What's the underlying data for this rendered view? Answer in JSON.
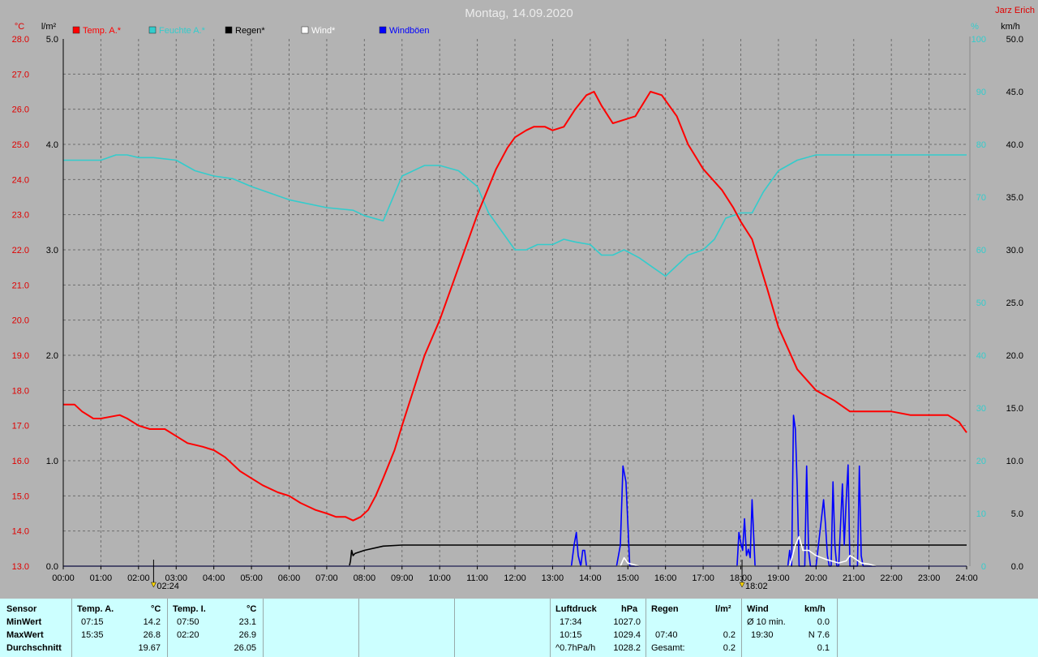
{
  "title": "Montag, 14.09.2020",
  "author": "Jarz Erich",
  "axes": {
    "left_temp_unit": "°C",
    "left_rain_unit": "l/m²",
    "right_hum_unit": "%",
    "right_wind_unit": "km/h",
    "temp_ticks": [
      "28.0",
      "27.0",
      "26.0",
      "25.0",
      "24.0",
      "23.0",
      "22.0",
      "21.0",
      "20.0",
      "19.0",
      "18.0",
      "17.0",
      "16.0",
      "15.0",
      "14.0",
      "13.0"
    ],
    "rain_ticks": [
      "5.0",
      "4.0",
      "3.0",
      "2.0",
      "1.0",
      "0.0"
    ],
    "hum_ticks": [
      "100",
      "90",
      "80",
      "70",
      "60",
      "50",
      "40",
      "30",
      "20",
      "10",
      "0"
    ],
    "wind_ticks": [
      "50.0",
      "45.0",
      "40.0",
      "35.0",
      "30.0",
      "25.0",
      "20.0",
      "15.0",
      "10.0",
      "5.0",
      "0.0"
    ],
    "time_ticks": [
      "00:00",
      "01:00",
      "02:00",
      "03:00",
      "04:00",
      "05:00",
      "06:00",
      "07:00",
      "08:00",
      "09:00",
      "10:00",
      "11:00",
      "12:00",
      "13:00",
      "14:00",
      "15:00",
      "16:00",
      "17:00",
      "18:00",
      "19:00",
      "20:00",
      "21:00",
      "22:00",
      "23:00",
      "24:00"
    ],
    "sunrise_label": "02:24",
    "sunset_label": "18:02"
  },
  "colors": {
    "temp": "#ff0000",
    "humidity": "#33cccc",
    "rain": "#000000",
    "wind": "#ffffff",
    "gusts": "#0000ff"
  },
  "chart_data": {
    "type": "line",
    "x_unit": "time of day (h)",
    "xlim": [
      0,
      24
    ],
    "series": [
      {
        "name": "Temp. A.*",
        "axis": "temp",
        "ylim": [
          13,
          28
        ],
        "x": [
          0,
          0.3,
          0.5,
          0.8,
          1.0,
          1.5,
          1.7,
          2.0,
          2.3,
          2.7,
          3.0,
          3.3,
          3.7,
          4.0,
          4.3,
          4.7,
          5.0,
          5.3,
          5.7,
          6.0,
          6.3,
          6.7,
          7.0,
          7.25,
          7.5,
          7.7,
          7.9,
          8.1,
          8.3,
          8.5,
          8.8,
          9.0,
          9.3,
          9.6,
          10.0,
          10.5,
          11.0,
          11.5,
          11.8,
          12.0,
          12.3,
          12.5,
          12.8,
          13.0,
          13.3,
          13.6,
          13.9,
          14.1,
          14.3,
          14.6,
          14.9,
          15.2,
          15.6,
          15.9,
          16.3,
          16.6,
          17.0,
          17.5,
          17.8,
          18.0,
          18.3,
          18.7,
          19.0,
          19.5,
          20.0,
          20.5,
          20.9,
          21.3,
          21.7,
          22.0,
          22.5,
          23.0,
          23.5,
          23.8,
          24.0
        ],
        "y": [
          17.6,
          17.6,
          17.4,
          17.2,
          17.2,
          17.3,
          17.2,
          17.0,
          16.9,
          16.9,
          16.7,
          16.5,
          16.4,
          16.3,
          16.1,
          15.7,
          15.5,
          15.3,
          15.1,
          15.0,
          14.8,
          14.6,
          14.5,
          14.4,
          14.4,
          14.3,
          14.4,
          14.6,
          15.0,
          15.5,
          16.3,
          17.0,
          18.0,
          19.0,
          20.0,
          21.5,
          23.0,
          24.3,
          24.9,
          25.2,
          25.4,
          25.5,
          25.5,
          25.4,
          25.5,
          26.0,
          26.4,
          26.5,
          26.1,
          25.6,
          25.7,
          25.8,
          26.5,
          26.4,
          25.8,
          25.0,
          24.3,
          23.7,
          23.2,
          22.8,
          22.3,
          20.9,
          19.8,
          18.6,
          18.0,
          17.7,
          17.4,
          17.4,
          17.4,
          17.4,
          17.3,
          17.3,
          17.3,
          17.1,
          16.8
        ]
      },
      {
        "name": "Feuchte A.*",
        "axis": "humidity",
        "ylim": [
          0,
          100
        ],
        "x": [
          0,
          1.0,
          1.4,
          1.7,
          2.0,
          2.4,
          3.0,
          3.5,
          4.0,
          4.5,
          5.0,
          6.0,
          7.0,
          7.7,
          8.0,
          8.5,
          9.0,
          9.6,
          10.0,
          10.5,
          11.0,
          11.3,
          11.7,
          12.0,
          12.3,
          12.6,
          13.0,
          13.3,
          13.6,
          14.0,
          14.3,
          14.6,
          14.9,
          15.3,
          15.7,
          16.0,
          16.3,
          16.6,
          17.0,
          17.3,
          17.6,
          18.0,
          18.3,
          18.6,
          19.0,
          19.5,
          20.0,
          22.0,
          24.0
        ],
        "y": [
          77,
          77,
          78,
          78,
          77.5,
          77.5,
          77,
          75,
          74,
          73.5,
          72,
          69.5,
          68,
          67.5,
          66.5,
          65.5,
          74,
          76,
          76,
          75,
          72,
          67,
          63,
          60,
          60,
          61,
          61,
          62,
          61.5,
          61,
          59,
          59,
          60,
          58.5,
          56.5,
          55,
          57,
          59,
          60,
          62,
          66,
          67,
          67,
          71,
          75,
          77,
          78,
          78,
          78
        ]
      },
      {
        "name": "Regen*",
        "axis": "rain",
        "ylim": [
          0,
          5
        ],
        "x": [
          0,
          7.6,
          7.63,
          7.66,
          7.7,
          7.75,
          8.0,
          8.5,
          9.0,
          24.0
        ],
        "y": [
          0,
          0,
          0.05,
          0.15,
          0.1,
          0.12,
          0.15,
          0.19,
          0.2,
          0.2
        ]
      },
      {
        "name": "Wind*",
        "axis": "wind",
        "ylim": [
          0,
          50
        ],
        "x": [
          0,
          14.8,
          14.9,
          15.0,
          15.1,
          15.3,
          19.3,
          19.45,
          19.55,
          19.65,
          19.8,
          20.0,
          20.3,
          20.6,
          20.8,
          20.9,
          21.0,
          21.2,
          21.4,
          21.6,
          24.0
        ],
        "y": [
          0,
          0,
          0.8,
          0.3,
          0.2,
          0,
          0,
          2.0,
          2.8,
          1.5,
          1.5,
          1.0,
          0.6,
          0.3,
          0.5,
          1.0,
          0.8,
          0.3,
          0.2,
          0,
          0
        ]
      },
      {
        "name": "Windböen",
        "axis": "wind",
        "ylim": [
          0,
          50
        ],
        "x": [
          0,
          13.5,
          13.57,
          13.63,
          13.68,
          13.75,
          13.8,
          13.85,
          13.9,
          14.7,
          14.8,
          14.87,
          14.95,
          15.05,
          17.9,
          17.95,
          18.0,
          18.05,
          18.1,
          18.15,
          18.2,
          18.25,
          18.3,
          18.38,
          18.43,
          18.5,
          19.25,
          19.3,
          19.35,
          19.4,
          19.45,
          19.5,
          19.55,
          19.62,
          19.7,
          19.75,
          19.8,
          19.85,
          19.9,
          19.95,
          20.0,
          20.2,
          20.25,
          20.3,
          20.35,
          20.4,
          20.45,
          20.5,
          20.55,
          20.6,
          20.7,
          20.75,
          20.8,
          20.85,
          20.9,
          20.95,
          21.0,
          21.05,
          21.1,
          21.15,
          21.2,
          21.25,
          21.3,
          21.35,
          21.4,
          24.0
        ],
        "y": [
          0,
          0,
          2.0,
          3.2,
          1.0,
          0,
          1.5,
          1.5,
          0,
          0,
          2.0,
          9.5,
          8.0,
          0,
          0,
          3.2,
          2.2,
          1.5,
          4.5,
          1.0,
          1.6,
          0.8,
          6.3,
          0,
          0,
          0,
          0,
          1.5,
          0,
          14.3,
          13.0,
          7.5,
          0,
          0,
          0,
          9.5,
          1.5,
          0,
          0,
          0,
          0,
          6.3,
          4.0,
          1.0,
          0,
          0,
          8.0,
          2.0,
          0,
          0,
          7.8,
          2.0,
          6.3,
          9.6,
          0,
          0,
          0,
          0,
          0,
          9.5,
          1.0,
          0,
          0,
          0,
          0,
          0
        ]
      }
    ]
  },
  "panel": {
    "sensor": {
      "header": "Sensor",
      "min": "MinWert",
      "max": "MaxWert",
      "avg": "Durchschnitt"
    },
    "temp_a": {
      "header": "Temp. A.",
      "unit": "°C",
      "min_time": "07:15",
      "min_val": "14.2",
      "max_time": "15:35",
      "max_val": "26.8",
      "avg_val": "19.67"
    },
    "temp_i": {
      "header": "Temp. I.",
      "unit": "°C",
      "min_time": "07:50",
      "min_val": "23.1",
      "max_time": "02:20",
      "max_val": "26.9",
      "avg_val": "26.05"
    },
    "pressure": {
      "header": "Luftdruck",
      "unit": "hPa",
      "min_time": "17:34",
      "min_val": "1027.0",
      "max_time": "10:15",
      "max_val": "1029.4",
      "avg_label": "^0.7hPa/h",
      "avg_val": "1028.2"
    },
    "rain": {
      "header": "Regen",
      "unit": "l/m²",
      "max_time": "07:40",
      "max_val": "0.2",
      "total_label": "Gesamt:",
      "total_val": "0.2"
    },
    "wind": {
      "header": "Wind",
      "unit": "km/h",
      "row1_label": "Ø 10 min.",
      "row1_val": "0.0",
      "row2_time": "19:30",
      "row2_val": "N 7.6",
      "row3_val": "0.1"
    }
  }
}
